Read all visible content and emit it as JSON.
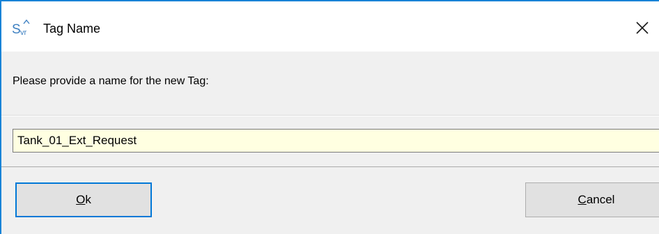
{
  "window": {
    "title": "Tag Name",
    "app_icon": "svr-app-icon",
    "close_icon": "close-icon"
  },
  "prompt": {
    "text": "Please provide a name for the new Tag:"
  },
  "tag_name_input": {
    "value": "Tank_01_Ext_Request"
  },
  "buttons": {
    "ok": {
      "mnemonic": "O",
      "rest": "k"
    },
    "cancel": {
      "mnemonic": "C",
      "rest": "ancel"
    }
  },
  "colors": {
    "window_border": "#1883d7",
    "titlebar_bg": "#ffffff",
    "dialog_bg": "#f0f0f0",
    "input_bg": "#ffffe1",
    "button_bg": "#e1e1e1",
    "default_button_border": "#0078d7",
    "icon_blue": "#3c7fc1"
  }
}
